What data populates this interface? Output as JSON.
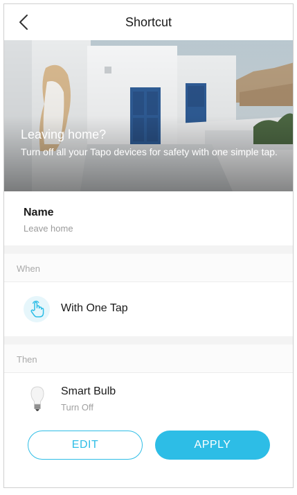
{
  "header": {
    "title": "Shortcut",
    "back_icon": "chevron-left-icon"
  },
  "hero": {
    "heading": "Leaving home?",
    "description": "Turn off all your Tapo devices for safety with one simple tap."
  },
  "name_section": {
    "label": "Name",
    "value": "Leave home"
  },
  "when_section": {
    "header": "When",
    "trigger_label": "With One Tap",
    "trigger_icon": "tap-hand-icon"
  },
  "then_section": {
    "header": "Then",
    "device_name": "Smart Bulb",
    "device_action": "Turn Off",
    "device_icon": "bulb-icon"
  },
  "actions": {
    "edit_label": "EDIT",
    "apply_label": "APPLY"
  },
  "colors": {
    "accent": "#2dbde6",
    "muted_text": "#a0a0a0"
  }
}
